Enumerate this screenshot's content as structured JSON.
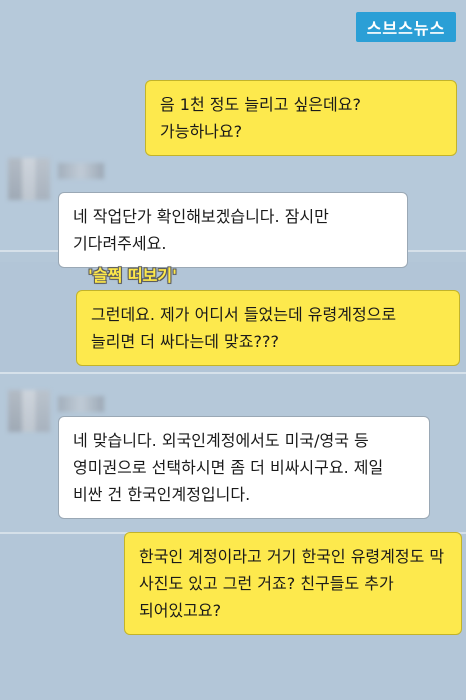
{
  "logo": {
    "text": "스브스뉴스"
  },
  "caption": "'슬쩍 떠보기'",
  "messages": [
    {
      "sender": "me",
      "text": "음 1천 정도 늘리고 싶은데요? 가능하나요?"
    },
    {
      "sender": "them",
      "text": "네 작업단가 확인해보겠습니다. 잠시만 기다려주세요."
    },
    {
      "sender": "me",
      "text": "그런데요. 제가 어디서 들었는데 유령계정으로 늘리면 더 싸다는데 맞죠???"
    },
    {
      "sender": "them",
      "text": "네 맞습니다. 외국인계정에서도 미국/영국 등 영미권으로 선택하시면 좀 더 비싸시구요. 제일 비싼 건 한국인계정입니다."
    },
    {
      "sender": "me",
      "text": "한국인 계정이라고 거기 한국인 유령계정도 막 사진도 있고 그런 거죠? 친구들도 추가 되어있고요?"
    }
  ],
  "colors": {
    "my_bubble": "#fde94d",
    "their_bubble": "#ffffff",
    "chat_background": "#b4c7d8",
    "caption": "#ffe94a",
    "logo_background": "#2b9fd6"
  },
  "icons": {
    "logo": "sbs-news-logo",
    "avatar": "blurred-profile-avatar"
  }
}
